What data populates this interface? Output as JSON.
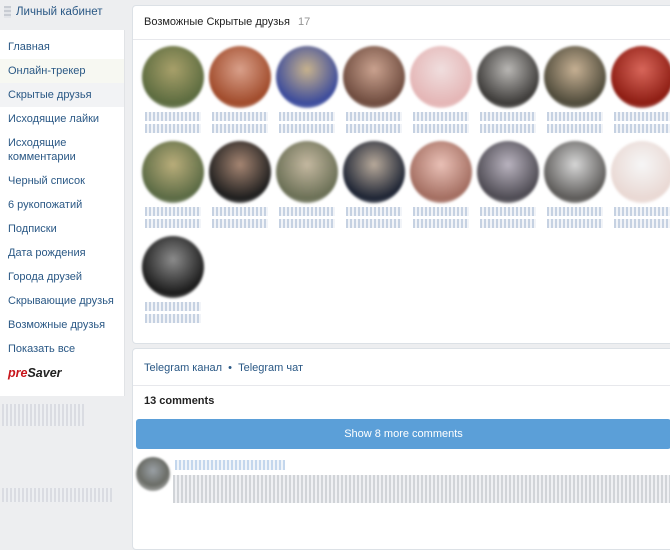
{
  "sidebar": {
    "cabinet_link": "Личный кабинет",
    "items": [
      {
        "label": "Главная"
      },
      {
        "label": "Онлайн-трекер"
      },
      {
        "label": "Скрытые друзья"
      },
      {
        "label": "Исходящие лайки"
      },
      {
        "label": "Исходящие комментарии"
      },
      {
        "label": "Черный список"
      },
      {
        "label": "6 рукопожатий"
      },
      {
        "label": "Подписки"
      },
      {
        "label": "Дата рождения"
      },
      {
        "label": "Города друзей"
      },
      {
        "label": "Скрывающие друзья"
      },
      {
        "label": "Возможные друзья"
      },
      {
        "label": "Показать все"
      }
    ],
    "brand": {
      "pre": "pre",
      "saver": "Saver"
    }
  },
  "friends": {
    "title": "Возможные Скрытые друзья",
    "count": "17",
    "avatar_colors": [
      [
        "#a8a06a",
        "#5b6b3f"
      ],
      [
        "#d9a08a",
        "#a04a2a"
      ],
      [
        "#c7b28d",
        "#3a4a9c"
      ],
      [
        "#caa28f",
        "#6e4b3e"
      ],
      [
        "#f0dede",
        "#e4b5b5"
      ],
      [
        "#b9b7b4",
        "#3c3a38"
      ],
      [
        "#c6b093",
        "#4e4a3a"
      ],
      [
        "#d8665a",
        "#8d1c12"
      ],
      [
        "#b9ad7a",
        "#5a6a44"
      ],
      [
        "#a58572",
        "#1d1d1d"
      ],
      [
        "#c4b8a0",
        "#6a6f55"
      ],
      [
        "#b7a99a",
        "#1c2333"
      ],
      [
        "#e9c0b6",
        "#a36d60"
      ],
      [
        "#b9b3bf",
        "#4d4a52"
      ],
      [
        "#d6d6d6",
        "#5c5a58"
      ],
      [
        "#f6f6f6",
        "#e9d8d3"
      ],
      [
        "#8c8c8c",
        "#1a1a1a"
      ]
    ]
  },
  "links": {
    "telegram_channel": "Telegram канал",
    "separator": "•",
    "telegram_chat": "Telegram чат"
  },
  "comments": {
    "title": "13 comments",
    "show_more": "Show 8 more comments"
  }
}
